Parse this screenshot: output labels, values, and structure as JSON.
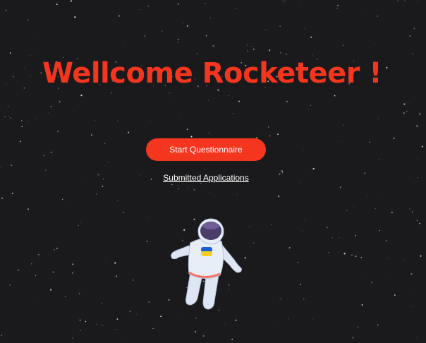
{
  "welcome": {
    "title": "Wellcome Rocketeer !"
  },
  "actions": {
    "start_label": "Start Questionnaire",
    "submitted_label": "Submitted Applications"
  },
  "illustration": {
    "icon": "astronaut-icon",
    "flag": "ukraine-flag"
  },
  "colors": {
    "background": "#1a1a1c",
    "accent": "#f4361f",
    "link": "#ffffff"
  }
}
